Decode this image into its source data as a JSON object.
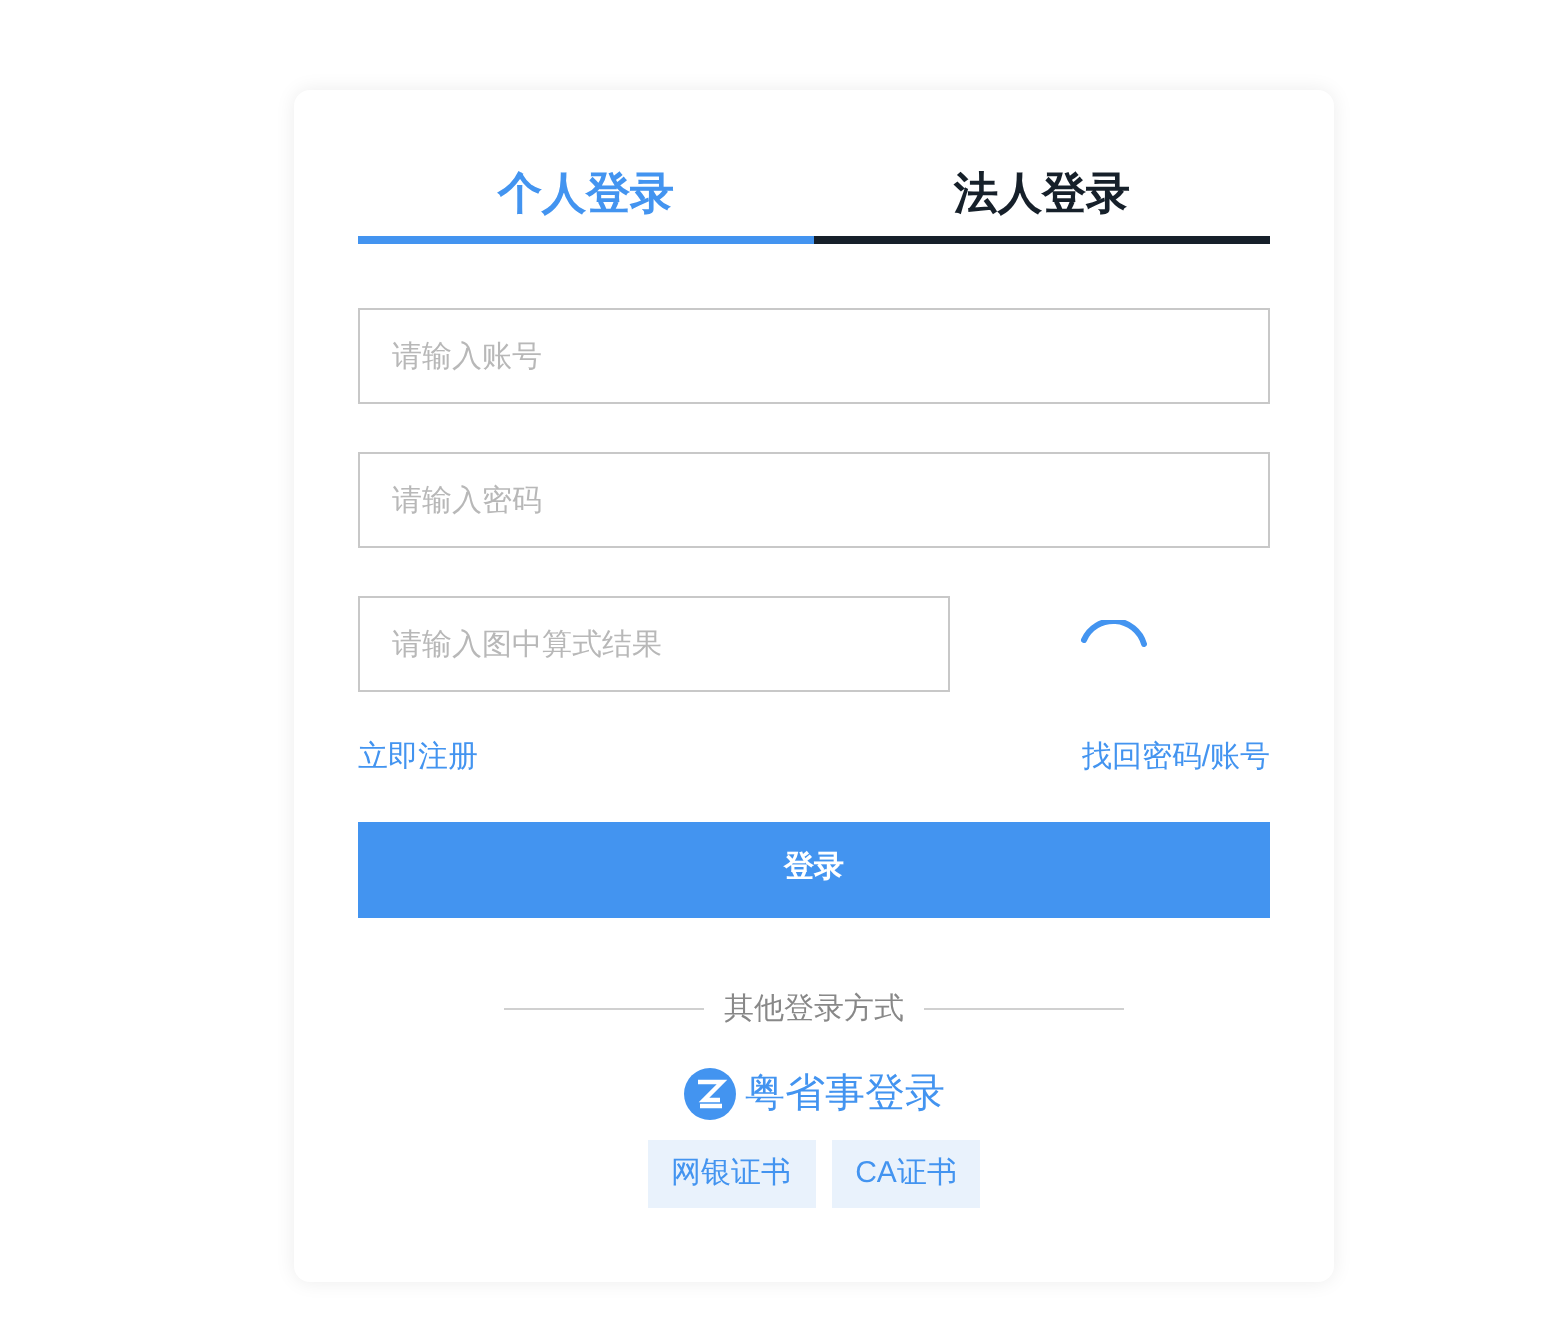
{
  "tabs": [
    {
      "label": "个人登录",
      "selected": true
    },
    {
      "label": "法人登录",
      "selected": false
    }
  ],
  "fields": [
    {
      "placeholder": "请输入账号"
    },
    {
      "placeholder": "请输入密码"
    }
  ],
  "captcha": {
    "placeholder": "请输入图中算式结果"
  },
  "links": {
    "register": "立即注册",
    "recover": "找回密码/账号"
  },
  "login_button": "登录",
  "other_methods": {
    "title": "其他登录方式",
    "app_login": "粤省事登录",
    "certificates": [
      "网银证书",
      "CA证书"
    ]
  }
}
